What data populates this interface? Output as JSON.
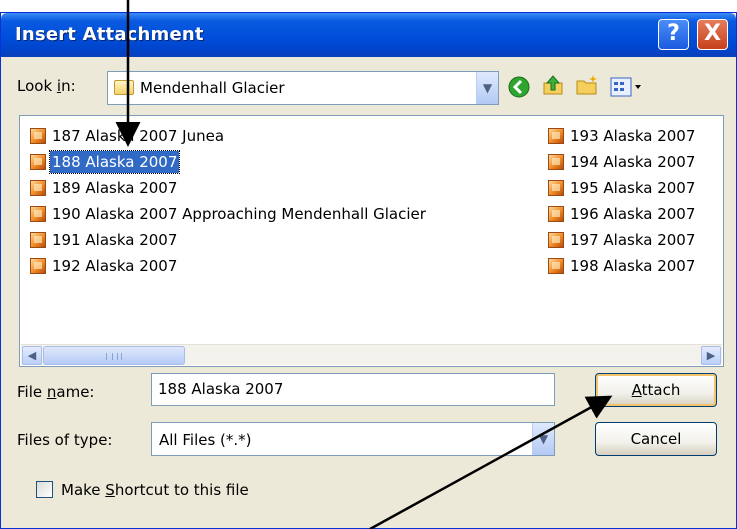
{
  "dialog": {
    "title": "Insert Attachment",
    "help_glyph": "?",
    "close_glyph": "X"
  },
  "look_in": {
    "label_pre": "Look ",
    "label_key": "i",
    "label_post": "n:",
    "value": "Mendenhall Glacier"
  },
  "toolbar": {
    "icons": [
      "back-icon",
      "up-folder-icon",
      "new-folder-icon",
      "views-menu-icon"
    ]
  },
  "files": {
    "left_column": [
      {
        "name": "187 Alaska 2007 Junea",
        "selected": false
      },
      {
        "name": "188 Alaska 2007",
        "selected": true
      },
      {
        "name": "189 Alaska 2007",
        "selected": false
      },
      {
        "name": "190 Alaska 2007 Approaching Mendenhall Glacier",
        "selected": false
      },
      {
        "name": "191 Alaska 2007",
        "selected": false
      },
      {
        "name": "192 Alaska 2007",
        "selected": false
      }
    ],
    "right_column": [
      {
        "name": "193 Alaska 2007",
        "selected": false
      },
      {
        "name": "194 Alaska 2007",
        "selected": false
      },
      {
        "name": "195 Alaska 2007",
        "selected": false
      },
      {
        "name": "196 Alaska 2007",
        "selected": false
      },
      {
        "name": "197 Alaska 2007",
        "selected": false
      },
      {
        "name": "198 Alaska 2007",
        "selected": false
      }
    ]
  },
  "file_name": {
    "label_pre": "File ",
    "label_key": "n",
    "label_post": "ame:",
    "value": "188 Alaska 2007"
  },
  "file_type": {
    "label": "Files of type:",
    "value": "All Files (*.*)"
  },
  "buttons": {
    "attach_key": "A",
    "attach_rest": "ttach",
    "cancel": "Cancel"
  },
  "shortcut": {
    "label_pre": "Make ",
    "label_key": "S",
    "label_post": "hortcut to this file",
    "checked": false
  },
  "colors": {
    "title_blue": "#0050dc",
    "selection": "#316ac5",
    "dialog_bg": "#ece9d8"
  }
}
